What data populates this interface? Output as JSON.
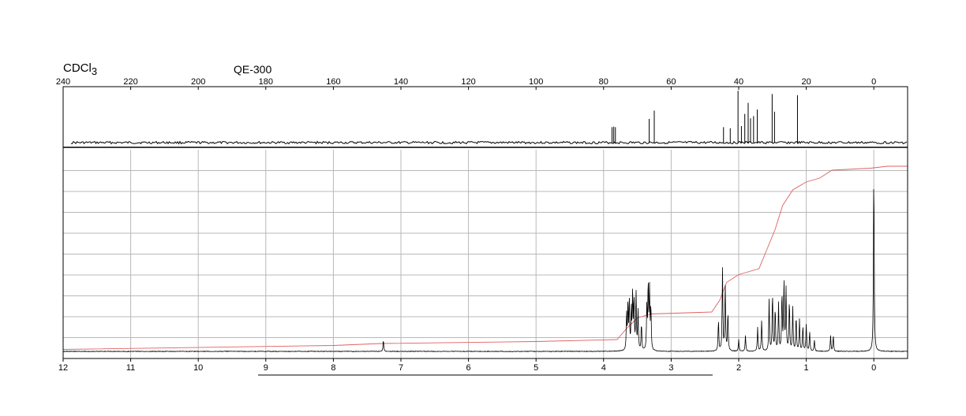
{
  "header": {
    "solvent_prefix": "CDCl",
    "solvent_subscript": "3",
    "instrument": "QE-300"
  },
  "chart_data": [
    {
      "type": "line",
      "name": "13C NMR spectrum",
      "x_axis": {
        "range": [
          240,
          -10
        ],
        "reversed": true,
        "ticks": [
          240,
          220,
          200,
          180,
          160,
          140,
          120,
          100,
          80,
          60,
          40,
          20,
          0
        ],
        "position": "top"
      },
      "y_axis": {
        "range": [
          0,
          1
        ],
        "shown": false
      },
      "grid": false,
      "peaks": [
        {
          "x": 77.5,
          "y": 0.28
        },
        {
          "x": 77.0,
          "y": 0.29
        },
        {
          "x": 76.5,
          "y": 0.28
        },
        {
          "x": 66.5,
          "y": 0.43
        },
        {
          "x": 65.0,
          "y": 0.58
        },
        {
          "x": 44.5,
          "y": 0.28
        },
        {
          "x": 42.5,
          "y": 0.26
        },
        {
          "x": 40.2,
          "y": 0.94
        },
        {
          "x": 39.2,
          "y": 0.3
        },
        {
          "x": 38.2,
          "y": 0.52
        },
        {
          "x": 37.2,
          "y": 0.72
        },
        {
          "x": 36.5,
          "y": 0.44
        },
        {
          "x": 35.6,
          "y": 0.48
        },
        {
          "x": 34.5,
          "y": 0.6
        },
        {
          "x": 30.1,
          "y": 0.88
        },
        {
          "x": 29.4,
          "y": 0.56
        },
        {
          "x": 22.6,
          "y": 0.86
        }
      ]
    },
    {
      "type": "line",
      "name": "1H NMR spectrum",
      "x_axis": {
        "range": [
          12,
          -0.5
        ],
        "reversed": true,
        "ticks": [
          12,
          11,
          10,
          9,
          8,
          7,
          6,
          5,
          4,
          3,
          2,
          1,
          0
        ],
        "position": "bottom"
      },
      "y_axis": {
        "range": [
          0,
          1
        ],
        "shown": false
      },
      "grid": true,
      "peaks": [
        {
          "x": 7.26,
          "y": 0.06
        },
        {
          "x": 3.66,
          "y": 0.18
        },
        {
          "x": 3.64,
          "y": 0.22
        },
        {
          "x": 3.62,
          "y": 0.26
        },
        {
          "x": 3.59,
          "y": 0.2
        },
        {
          "x": 3.57,
          "y": 0.28
        },
        {
          "x": 3.55,
          "y": 0.26
        },
        {
          "x": 3.52,
          "y": 0.3
        },
        {
          "x": 3.49,
          "y": 0.2
        },
        {
          "x": 3.44,
          "y": 0.14
        },
        {
          "x": 3.36,
          "y": 0.22
        },
        {
          "x": 3.34,
          "y": 0.34
        },
        {
          "x": 3.32,
          "y": 0.3
        },
        {
          "x": 3.3,
          "y": 0.22
        },
        {
          "x": 2.3,
          "y": 0.16
        },
        {
          "x": 2.24,
          "y": 0.42
        },
        {
          "x": 2.2,
          "y": 0.34
        },
        {
          "x": 2.16,
          "y": 0.2
        },
        {
          "x": 2.0,
          "y": 0.06
        },
        {
          "x": 1.9,
          "y": 0.08
        },
        {
          "x": 1.72,
          "y": 0.12
        },
        {
          "x": 1.66,
          "y": 0.16
        },
        {
          "x": 1.55,
          "y": 0.26
        },
        {
          "x": 1.5,
          "y": 0.3
        },
        {
          "x": 1.46,
          "y": 0.22
        },
        {
          "x": 1.41,
          "y": 0.24
        },
        {
          "x": 1.36,
          "y": 0.3
        },
        {
          "x": 1.33,
          "y": 0.36
        },
        {
          "x": 1.3,
          "y": 0.32
        },
        {
          "x": 1.25,
          "y": 0.26
        },
        {
          "x": 1.2,
          "y": 0.22
        },
        {
          "x": 1.15,
          "y": 0.18
        },
        {
          "x": 1.1,
          "y": 0.16
        },
        {
          "x": 1.05,
          "y": 0.13
        },
        {
          "x": 1.0,
          "y": 0.14
        },
        {
          "x": 0.95,
          "y": 0.1
        },
        {
          "x": 0.88,
          "y": 0.06
        },
        {
          "x": 0.64,
          "y": 0.08
        },
        {
          "x": 0.6,
          "y": 0.08
        },
        {
          "x": 0.0,
          "y": 0.95
        }
      ],
      "integral": [
        {
          "x": 12.0,
          "y": 0.01
        },
        {
          "x": 8.0,
          "y": 0.03
        },
        {
          "x": 7.3,
          "y": 0.04
        },
        {
          "x": 5.0,
          "y": 0.05
        },
        {
          "x": 3.8,
          "y": 0.06
        },
        {
          "x": 3.65,
          "y": 0.12
        },
        {
          "x": 3.5,
          "y": 0.17
        },
        {
          "x": 3.3,
          "y": 0.19
        },
        {
          "x": 2.4,
          "y": 0.2
        },
        {
          "x": 2.28,
          "y": 0.26
        },
        {
          "x": 2.18,
          "y": 0.35
        },
        {
          "x": 2.0,
          "y": 0.39
        },
        {
          "x": 1.7,
          "y": 0.42
        },
        {
          "x": 1.58,
          "y": 0.52
        },
        {
          "x": 1.46,
          "y": 0.62
        },
        {
          "x": 1.35,
          "y": 0.74
        },
        {
          "x": 1.2,
          "y": 0.82
        },
        {
          "x": 1.0,
          "y": 0.86
        },
        {
          "x": 0.8,
          "y": 0.88
        },
        {
          "x": 0.62,
          "y": 0.92
        },
        {
          "x": 0.05,
          "y": 0.93
        },
        {
          "x": -0.2,
          "y": 0.94
        },
        {
          "x": -0.5,
          "y": 0.94
        }
      ]
    }
  ]
}
